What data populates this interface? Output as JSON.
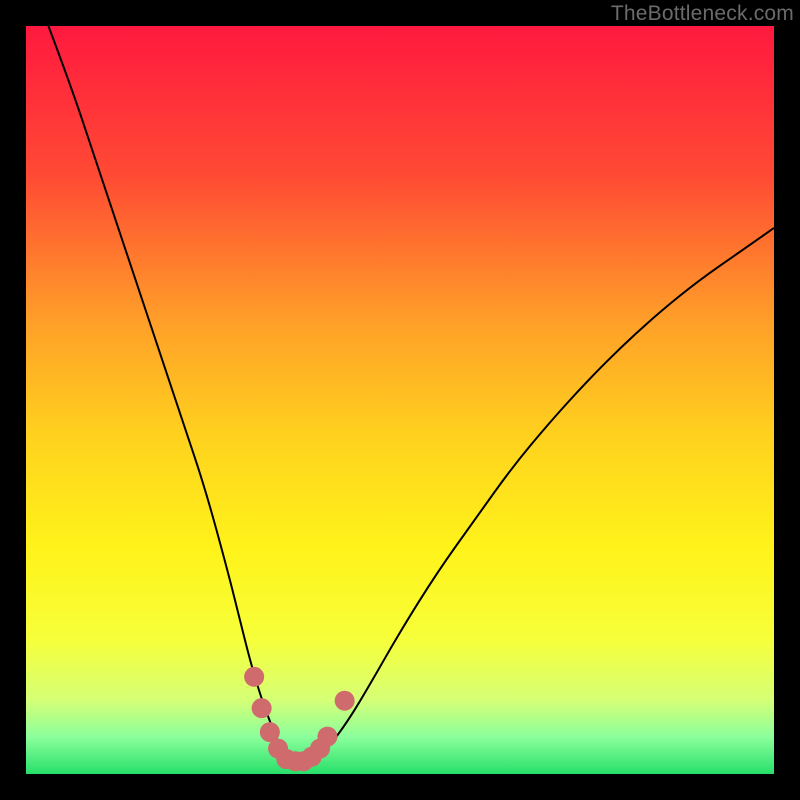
{
  "watermark": "TheBottleneck.com",
  "chart_data": {
    "type": "line",
    "title": "",
    "xlabel": "",
    "ylabel": "",
    "xlim": [
      0,
      100
    ],
    "ylim": [
      0,
      100
    ],
    "grid": false,
    "legend": false,
    "background_gradient_stops": [
      {
        "offset": 0.0,
        "color": "#ff193f"
      },
      {
        "offset": 0.2,
        "color": "#ff4a34"
      },
      {
        "offset": 0.4,
        "color": "#ffa128"
      },
      {
        "offset": 0.55,
        "color": "#ffd21e"
      },
      {
        "offset": 0.7,
        "color": "#fff31a"
      },
      {
        "offset": 0.82,
        "color": "#f6ff3a"
      },
      {
        "offset": 0.9,
        "color": "#d6ff75"
      },
      {
        "offset": 0.95,
        "color": "#8cff9c"
      },
      {
        "offset": 1.0,
        "color": "#27e06a"
      }
    ],
    "series": [
      {
        "name": "bottleneck-curve",
        "color": "#000000",
        "stroke_width": 2,
        "x": [
          3,
          6,
          9,
          12,
          15,
          18,
          21,
          24,
          27,
          28.5,
          30,
          31.5,
          33,
          34,
          35,
          36,
          37,
          38.5,
          40,
          43,
          46,
          50,
          55,
          60,
          65,
          70,
          75,
          80,
          85,
          90,
          95,
          100
        ],
        "y": [
          100,
          92,
          83,
          74,
          65,
          56,
          47,
          38,
          27,
          21,
          15,
          10,
          6,
          3.5,
          2,
          1.3,
          1.3,
          1.8,
          3,
          7,
          12,
          19,
          27,
          34,
          41,
          47,
          52.5,
          57.5,
          62,
          66,
          69.5,
          73
        ]
      }
    ],
    "highlight_points": {
      "name": "optimal-range-markers",
      "color": "#cf6a6d",
      "radius": 10,
      "x": [
        30.5,
        31.5,
        32.6,
        33.7,
        34.8,
        36.0,
        37.1,
        38.2,
        39.3,
        40.3,
        42.6
      ],
      "y": [
        13.0,
        8.8,
        5.6,
        3.4,
        2.0,
        1.7,
        1.7,
        2.3,
        3.4,
        5.0,
        9.8
      ]
    }
  }
}
